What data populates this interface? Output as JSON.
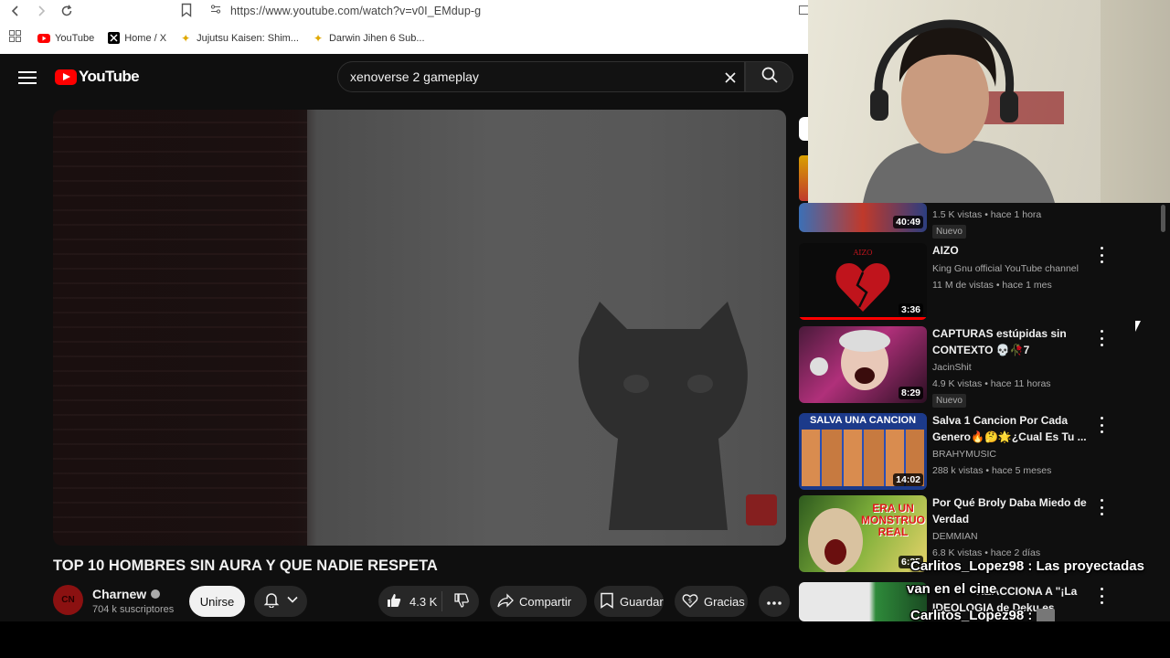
{
  "browser": {
    "url": "https://www.youtube.com/watch?v=v0I_EMdup-g",
    "bookmarks": [
      {
        "label": "YouTube",
        "icon": "youtube-icon"
      },
      {
        "label": "Home / X",
        "icon": "x-icon"
      },
      {
        "label": "Jujutsu Kaisen: Shim...",
        "icon": "sparkle-icon"
      },
      {
        "label": "Darwin Jihen 6 Sub...",
        "icon": "sparkle-icon"
      }
    ]
  },
  "header": {
    "logo_text": "YouTube",
    "search_value": "xenoverse 2 gameplay"
  },
  "video": {
    "title": "TOP 10 HOMBRES SIN AURA Y QUE NADIE RESPETA",
    "channel": "Charnew",
    "subscribers": "704 k suscriptores",
    "join_label": "Unirse",
    "likes": "4.3 K",
    "share_label": "Compartir",
    "save_label": "Guardar",
    "thanks_label": "Gracias"
  },
  "recommendations": [
    {
      "duration": "40:49",
      "meta_line": "1.5 K vistas • hace 1 hora",
      "badge": "Nuevo"
    },
    {
      "title": "AIZO",
      "channel": "King Gnu official YouTube channel",
      "meta_line": "11 M de vistas • hace 1 mes",
      "duration": "3:36"
    },
    {
      "title_line1": "CAPTURAS estúpidas sin",
      "title_line2": "CONTEXTO 💀🥀7",
      "channel": "JacinShit",
      "meta_line": "4.9 K vistas • hace 11 horas",
      "badge": "Nuevo",
      "duration": "8:29"
    },
    {
      "title_line1": "Salva 1 Cancion Por Cada",
      "title_line2": "Genero🔥🤔🌟¿Cual Es Tu ...",
      "channel": "BRAHYMUSIC",
      "meta_line": "288 k vistas • hace 5 meses",
      "duration": "14:02",
      "thumb_text": "SALVA UNA CANCION"
    },
    {
      "title_line1": "Por Qué Broly Daba Miedo de",
      "title_line2": "Verdad",
      "channel": "DEMMIAN",
      "meta_line": "6.8 K vistas • hace 2 días",
      "duration": "6:35",
      "thumb_text": "ERA UN MONSTRUO REAL"
    },
    {
      "title_line1": "REACCIONA A \"¡La",
      "title_line2": "IDEOLOGIA de Deku es"
    }
  ],
  "chat": {
    "line1_user": "Carlitos_Lopez98",
    "line1_text": ": Las proyectadas",
    "line1_cont": "van en el cine",
    "line2_user": "Carlitos_Lopez98",
    "line2_text": ":"
  },
  "colors": {
    "accent": "#ff0000",
    "background": "#0f0f0f",
    "pill": "#272727"
  }
}
